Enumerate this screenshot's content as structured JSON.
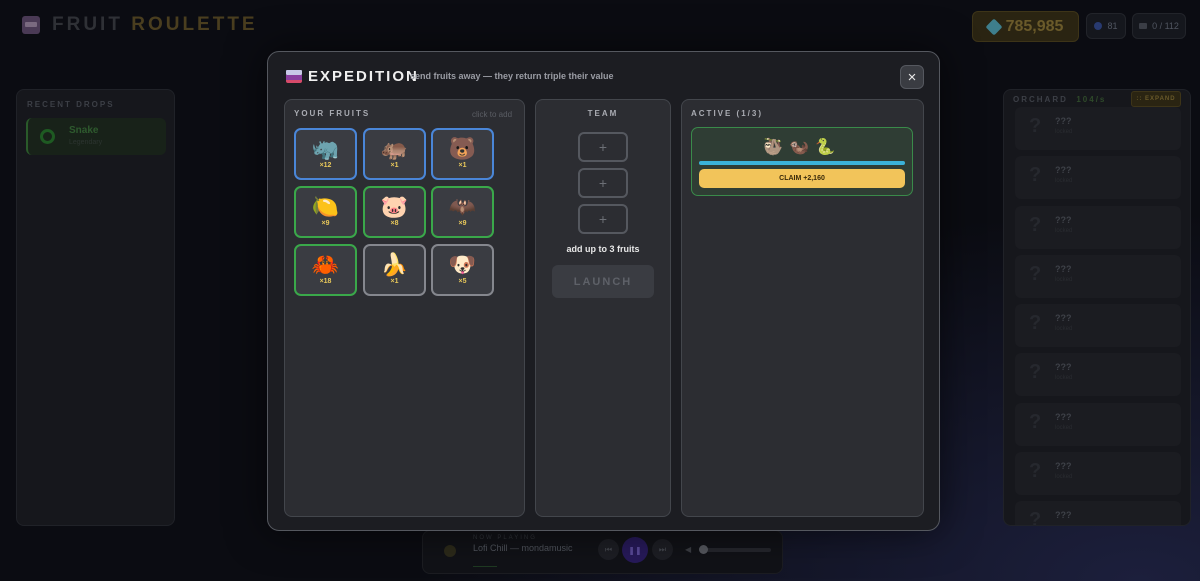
{
  "header": {
    "title_a": "FRUIT",
    "title_b": "ROULETTE",
    "gems": "785,985",
    "level": "81",
    "inventory": "0 / 112"
  },
  "recent": {
    "title": "RECENT DROPS",
    "items": [
      {
        "name": "Snake",
        "sub": "Legendary"
      }
    ]
  },
  "orchard": {
    "title": "ORCHARD",
    "rate": "104/s",
    "expand": ":: EXPAND",
    "items": [
      {
        "name": "???",
        "sub": "locked"
      },
      {
        "name": "???",
        "sub": "locked"
      },
      {
        "name": "???",
        "sub": "locked"
      },
      {
        "name": "???",
        "sub": "locked"
      },
      {
        "name": "???",
        "sub": "locked"
      },
      {
        "name": "???",
        "sub": "locked"
      },
      {
        "name": "???",
        "sub": "locked"
      },
      {
        "name": "???",
        "sub": "locked"
      },
      {
        "name": "???",
        "sub": ""
      }
    ]
  },
  "player": {
    "now_playing": "NOW PLAYING",
    "song": "Lofi Chill — mondamusic"
  },
  "modal": {
    "title": "EXPEDITION",
    "subtitle": "send fruits away — they return triple their value",
    "close": "×",
    "your_fruits": {
      "title": "YOUR FRUITS",
      "hint": "click to add",
      "items": [
        {
          "emoji": "🦏",
          "count": "×12",
          "rarity": "blue"
        },
        {
          "emoji": "🦛",
          "count": "×1",
          "rarity": "blue"
        },
        {
          "emoji": "🐻",
          "count": "×1",
          "rarity": "blue"
        },
        {
          "emoji": "🍋",
          "count": "×9",
          "rarity": "green"
        },
        {
          "emoji": "🐷",
          "count": "×8",
          "rarity": "green"
        },
        {
          "emoji": "🦇",
          "count": "×9",
          "rarity": "green"
        },
        {
          "emoji": "🦀",
          "count": "×18",
          "rarity": "green"
        },
        {
          "emoji": "🍌",
          "count": "×1",
          "rarity": "grey"
        },
        {
          "emoji": "🐶",
          "count": "×5",
          "rarity": "grey"
        }
      ]
    },
    "team": {
      "title": "TEAM",
      "slots": [
        "+",
        "+",
        "+"
      ],
      "hint": "add up to 3 fruits",
      "launch": "LAUNCH"
    },
    "active": {
      "title": "ACTIVE (1/3)",
      "expedition": {
        "fruits": "🦥🦦🐍",
        "progress": 1.0,
        "claim": "CLAIM +2,160"
      }
    }
  }
}
